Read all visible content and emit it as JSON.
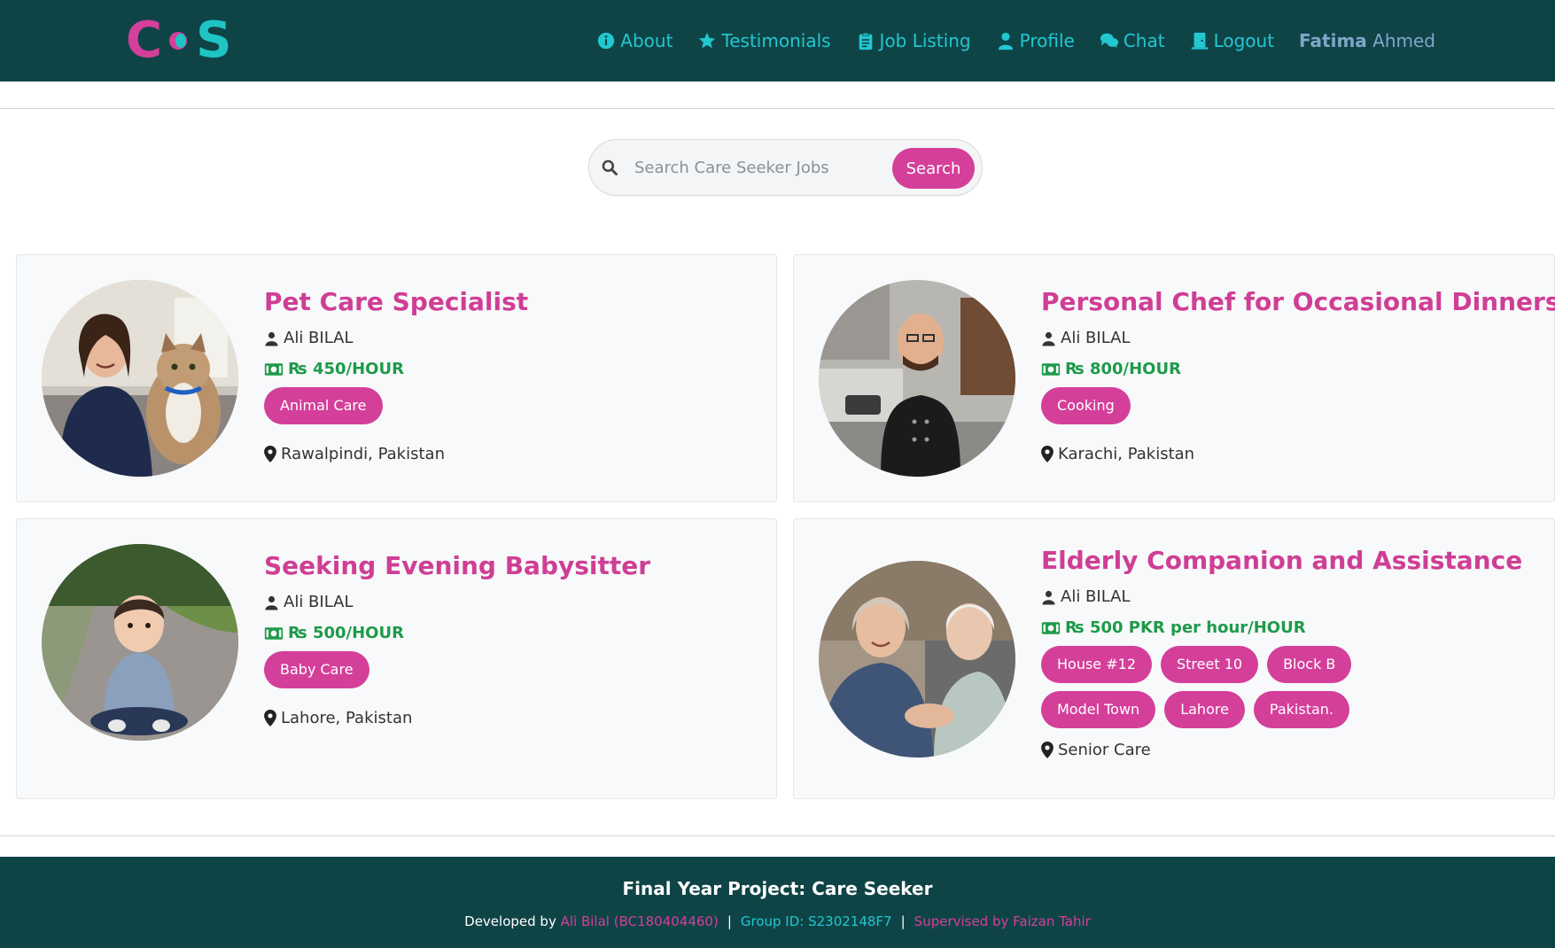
{
  "brand": {
    "logo_left": "C",
    "logo_right": "S"
  },
  "nav": {
    "items": [
      {
        "label": "About",
        "icon": "info-circle-icon"
      },
      {
        "label": "Testimonials",
        "icon": "star-icon"
      },
      {
        "label": "Job Listing",
        "icon": "clipboard-icon"
      },
      {
        "label": "Profile",
        "icon": "user-icon"
      },
      {
        "label": "Chat",
        "icon": "comments-icon"
      },
      {
        "label": "Logout",
        "icon": "door-exit-icon"
      }
    ],
    "user_first": "Fatima",
    "user_last": " Ahmed"
  },
  "search": {
    "placeholder": "Search Care Seeker Jobs",
    "button_label": "Search"
  },
  "jobs": [
    {
      "title": "Pet Care Specialist",
      "poster": "Ali BILAL",
      "rate": "₨ 450/HOUR",
      "tags": [
        "Animal Care"
      ],
      "location": "Rawalpindi, Pakistan"
    },
    {
      "title": "Personal Chef for Occasional Dinners",
      "poster": "Ali BILAL",
      "rate": "₨ 800/HOUR",
      "tags": [
        "Cooking"
      ],
      "location": "Karachi, Pakistan"
    },
    {
      "title": "Seeking Evening Babysitter",
      "poster": "Ali BILAL",
      "rate": "₨ 500/HOUR",
      "tags": [
        "Baby Care"
      ],
      "location": "Lahore, Pakistan"
    },
    {
      "title": "Elderly Companion and Assistance",
      "poster": "Ali BILAL",
      "rate": "₨ 500 PKR per hour/HOUR",
      "tags": [
        "House #12",
        "Street 10",
        "Block B",
        "Model Town",
        "Lahore",
        "Pakistan."
      ],
      "location": "Senior Care"
    }
  ],
  "footer": {
    "title": "Final Year Project: Care Seeker",
    "developed_prefix": "Developed by ",
    "developer": "Ali Bilal (BC180404460)",
    "group": "Group ID: S2302148F7",
    "supervisor": "Supervised by Faizan Tahir",
    "separator": "|"
  },
  "colors": {
    "navbar_bg": "#0f4447",
    "accent_pink": "#d43f9a",
    "accent_teal": "#22c7d0",
    "price_green": "#1e9a4a"
  }
}
